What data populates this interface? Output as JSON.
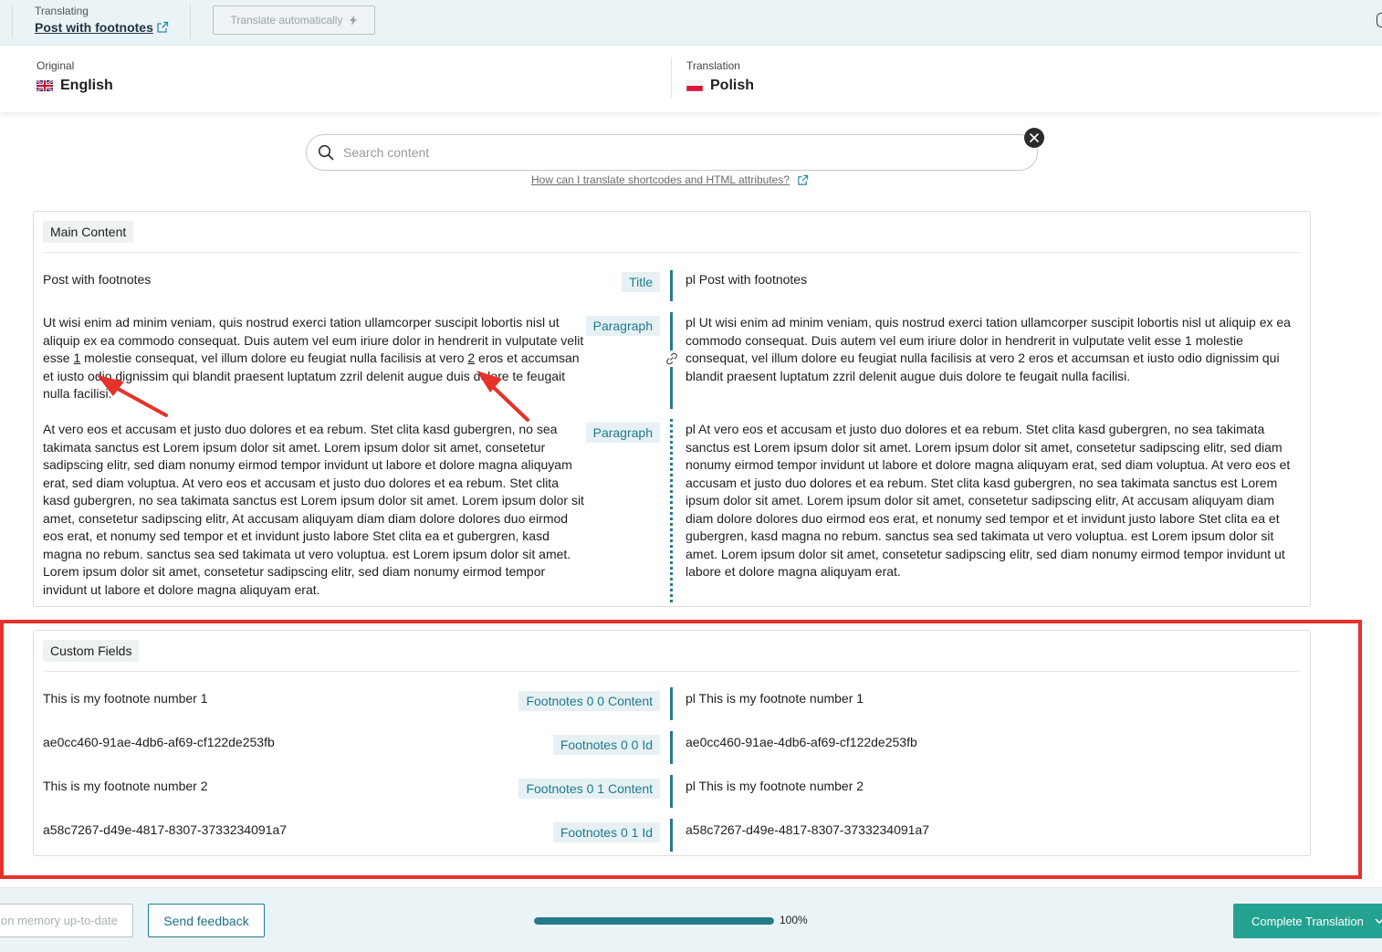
{
  "header": {
    "context_label": "Translating",
    "post_title": "Post with footnotes",
    "translate_auto_label": "Translate automatically"
  },
  "languages": {
    "original": {
      "label": "Original",
      "name": "English"
    },
    "translation": {
      "label": "Translation",
      "name": "Polish"
    }
  },
  "search": {
    "placeholder": "Search content",
    "help_link": "How can I translate shortcodes and HTML attributes?"
  },
  "main_content": {
    "heading": "Main Content",
    "rows": [
      {
        "source": "Post with footnotes",
        "tag": "Title",
        "target": "pl Post with footnotes"
      },
      {
        "source_a": "Ut wisi enim ad minim veniam, quis nostrud exerci tation ullamcorper suscipit lobortis nisl ut aliquip ex ea commodo consequat. Duis autem vel eum iriure dolor in hendrerit in vulputate velit esse ",
        "source_fn1": "1",
        "source_b": " molestie consequat, vel illum dolore eu feugiat nulla facilisis at vero ",
        "source_fn2": "2",
        "source_c": " eros et accumsan et iusto odio dignissim qui blandit praesent luptatum zzril delenit augue duis dolore te feugait nulla facilisi.",
        "tag": "Paragraph",
        "target": "pl Ut wisi enim ad minim veniam, quis nostrud exerci tation ullamcorper suscipit lobortis nisl ut aliquip ex ea commodo consequat. Duis autem vel eum iriure dolor in hendrerit in vulputate velit esse 1 molestie consequat, vel illum dolore eu feugiat nulla facilisis at vero 2 eros et accumsan et iusto odio dignissim qui blandit praesent luptatum zzril delenit augue duis dolore te feugait nulla facilisi."
      },
      {
        "source": "At vero eos et accusam et justo duo dolores et ea rebum. Stet clita kasd gubergren, no sea takimata sanctus est Lorem ipsum dolor sit amet. Lorem ipsum dolor sit amet, consetetur sadipscing elitr, sed diam nonumy eirmod tempor invidunt ut labore et dolore magna aliquyam erat, sed diam voluptua. At vero eos et accusam et justo duo dolores et ea rebum. Stet clita kasd gubergren, no sea takimata sanctus est Lorem ipsum dolor sit amet. Lorem ipsum dolor sit amet, consetetur sadipscing elitr, At accusam aliquyam diam diam dolore dolores duo eirmod eos erat, et nonumy sed tempor et et invidunt justo labore Stet clita ea et gubergren, kasd magna no rebum. sanctus sea sed takimata ut vero voluptua. est Lorem ipsum dolor sit amet. Lorem ipsum dolor sit amet, consetetur sadipscing elitr, sed diam nonumy eirmod tempor invidunt ut labore et dolore magna aliquyam erat.",
        "tag": "Paragraph",
        "target": "pl At vero eos et accusam et justo duo dolores et ea rebum. Stet clita kasd gubergren, no sea takimata sanctus est Lorem ipsum dolor sit amet. Lorem ipsum dolor sit amet, consetetur sadipscing elitr, sed diam nonumy eirmod tempor invidunt ut labore et dolore magna aliquyam erat, sed diam voluptua. At vero eos et accusam et justo duo dolores et ea rebum. Stet clita kasd gubergren, no sea takimata sanctus est Lorem ipsum dolor sit amet. Lorem ipsum dolor sit amet, consetetur sadipscing elitr, At accusam aliquyam diam diam dolore dolores duo eirmod eos erat, et nonumy sed tempor et et invidunt justo labore Stet clita ea et gubergren, kasd magna no rebum. sanctus sea sed takimata ut vero voluptua. est Lorem ipsum dolor sit amet. Lorem ipsum dolor sit amet, consetetur sadipscing elitr, sed diam nonumy eirmod tempor invidunt ut labore et dolore magna aliquyam erat."
      }
    ]
  },
  "custom_fields": {
    "heading": "Custom Fields",
    "rows": [
      {
        "source": "This is my footnote number 1",
        "tag": "Footnotes 0 0 Content",
        "target": "pl This is my footnote number 1"
      },
      {
        "source": "ae0cc460-91ae-4db6-af69-cf122de253fb",
        "tag": "Footnotes 0 0 Id",
        "target": "ae0cc460-91ae-4db6-af69-cf122de253fb"
      },
      {
        "source": "This is my footnote number 2",
        "tag": "Footnotes 0 1 Content",
        "target": "pl This is my footnote number 2"
      },
      {
        "source": "a58c7267-d49e-4817-8307-3733234091a7",
        "tag": "Footnotes 0 1 Id",
        "target": "a58c7267-d49e-4817-8307-3733234091a7"
      }
    ]
  },
  "footer": {
    "memory_label": "on memory up-to-date",
    "feedback_label": "Send feedback",
    "progress_percent": 100,
    "progress_text": "100%",
    "complete_label": "Complete Translation"
  },
  "colors": {
    "accent": "#257a8c",
    "primary_button": "#24a291",
    "annotation": "#e5322a",
    "tag_bg": "#e7f1f3"
  },
  "icons": [
    "external-link-icon",
    "bolt-icon",
    "uk-flag-icon",
    "poland-flag-icon",
    "search-icon",
    "close-icon",
    "link-icon",
    "chevron-down-icon"
  ]
}
